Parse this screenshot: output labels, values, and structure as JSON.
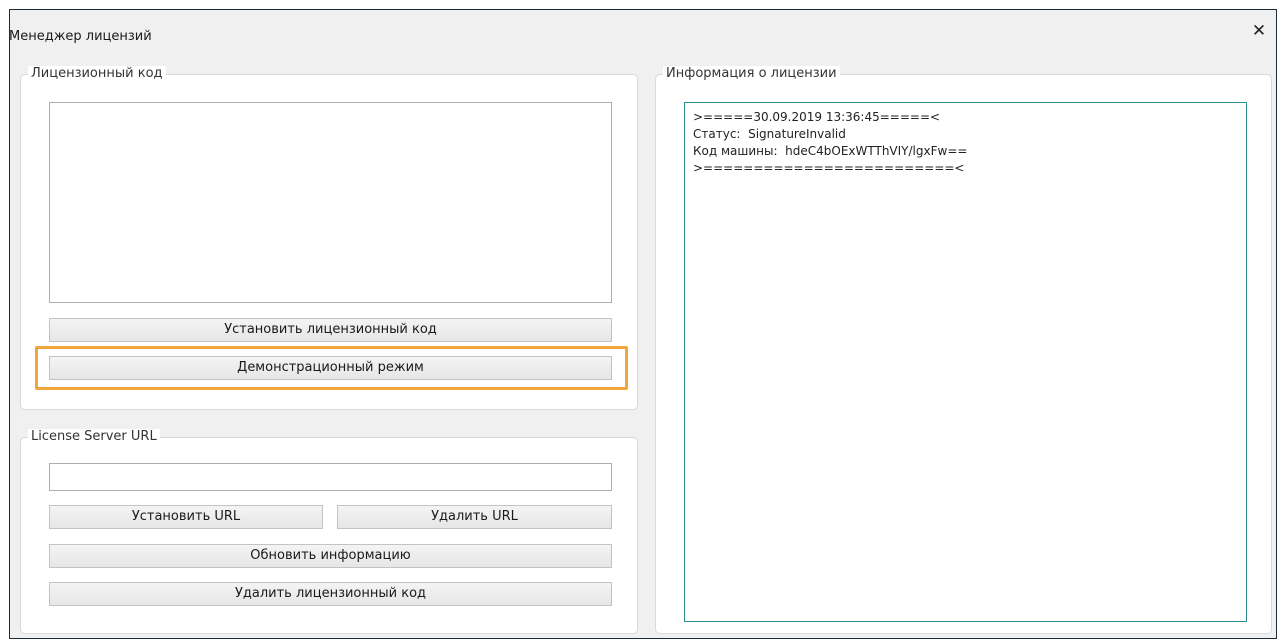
{
  "window": {
    "title": "Менеджер лицензий",
    "close_glyph": "✕"
  },
  "license_code": {
    "legend": "Лицензионный код",
    "textarea_value": "",
    "install_button": "Установить лицензионный код",
    "demo_button": "Демонстрационный режим"
  },
  "license_server": {
    "legend": "License Server URL",
    "url_value": "",
    "set_url_button": "Установить URL",
    "delete_url_button": "Удалить URL",
    "refresh_button": "Обновить информацию",
    "delete_code_button": "Удалить лицензионный код"
  },
  "license_info": {
    "legend": "Информация о лицензии",
    "lines": [
      ">=====30.09.2019 13:36:45=====<",
      "Статус:  SignatureInvalid",
      "Код машины:  hdeC4bOExWTThVIY/lgxFw==",
      ">=========================<"
    ]
  },
  "colors": {
    "highlight": "#f0a63a",
    "info_border": "#2b8a8a",
    "window_border": "#1e2a36"
  }
}
